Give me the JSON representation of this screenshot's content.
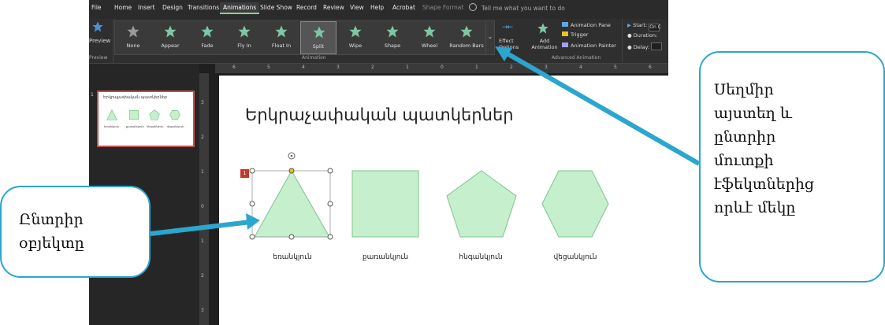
{
  "menu": {
    "items": [
      "File",
      "Home",
      "Insert",
      "Design",
      "Transitions",
      "Animations",
      "Slide Show",
      "Record",
      "Review",
      "View",
      "Help",
      "Acrobat",
      "Shape Format"
    ],
    "active": "Animations",
    "tell_me": "Tell me what you want to do"
  },
  "ribbon": {
    "preview_label": "Preview",
    "preview_group": "Preview",
    "gallery": [
      {
        "label": "None",
        "icon": "star-icon-gray"
      },
      {
        "label": "Appear",
        "icon": "star-icon-green"
      },
      {
        "label": "Fade",
        "icon": "star-icon-green"
      },
      {
        "label": "Fly In",
        "icon": "star-icon-green"
      },
      {
        "label": "Float In",
        "icon": "star-icon-green"
      },
      {
        "label": "Split",
        "icon": "star-icon-green"
      },
      {
        "label": "Wipe",
        "icon": "star-icon-green"
      },
      {
        "label": "Shape",
        "icon": "star-icon-green"
      },
      {
        "label": "Wheel",
        "icon": "star-icon-green"
      },
      {
        "label": "Random Bars",
        "icon": "star-icon-green"
      }
    ],
    "selected": "Split",
    "animation_group": "Animation",
    "effect_options_1": "Effect",
    "effect_options_2": "Options",
    "add_animation_1": "Add",
    "add_animation_2": "Animation",
    "animation_pane": "Animation Pane",
    "trigger": "Trigger",
    "animation_painter": "Animation Painter",
    "advanced_group": "Advanced Animation",
    "start_label": "Start:",
    "start_value": "On C",
    "duration_label": "Duration:",
    "delay_label": "Delay:"
  },
  "thumbnail": {
    "number": "1",
    "title": "Երկրաչափական պատկերներ",
    "captions": [
      "եռանկյուն",
      "քառանկյուն",
      "հնգանկյուն",
      "վեցանկյուն"
    ]
  },
  "ruler_top": [
    "6",
    "5",
    "4",
    "3",
    "2",
    "1",
    "0",
    "1",
    "2",
    "3",
    "4",
    "5",
    "6"
  ],
  "ruler_left": [
    "3",
    "2",
    "1",
    "0",
    "1",
    "2",
    "3"
  ],
  "slide": {
    "title": "Երկրաչափական պատկերներ",
    "animation_tag": "1",
    "shapes": [
      {
        "name": "triangle",
        "caption": "եռանկյուն"
      },
      {
        "name": "square",
        "caption": "քառանկյուն"
      },
      {
        "name": "pentagon",
        "caption": "հնգանկյուն"
      },
      {
        "name": "hexagon",
        "caption": "վեցանկյուն"
      }
    ],
    "shape_fill": "#c6efce",
    "shape_stroke": "#7cc48a"
  },
  "callouts": {
    "left": [
      "Ընտրիր",
      "օբյեկտը"
    ],
    "right": [
      "Սեղմիր",
      "այստեղ և",
      "ընտրիր",
      "մուտքի",
      "էֆեկտներից",
      "որևէ մեկը"
    ],
    "color": "#2aa6cf"
  }
}
